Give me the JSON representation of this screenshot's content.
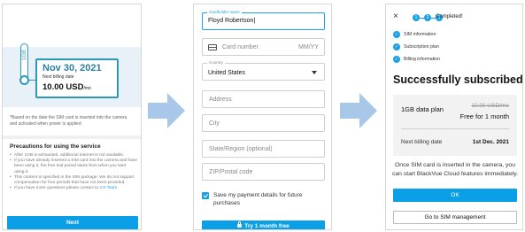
{
  "colors": {
    "accent": "#0a9fe6",
    "arrow": "#a9c7e8",
    "timeline": "#2c9ab7"
  },
  "panel1": {
    "timeline_label": "1GB",
    "billing_date": "Nov 30, 2021",
    "billing_caption": "Next billing date",
    "price": "10.00 USD",
    "price_unit": "/mo",
    "note": "*Based on the date the SIM card is inserted into the camera and activated when power is applied",
    "precautions_title": "Precautions for using the service",
    "precautions": [
      "After 1GB is exhausted, additional internet is not available.",
      "If you have already inserted a SIM card into the camera and have been using it, the free trial period starts from when you start using it.",
      "This content is specified in the SIM package. We do not support compensation for free periods that have not been provided.",
      "If you have more questions please contact to"
    ],
    "cs_link": "CS Team",
    "next_button": "Next"
  },
  "panel2": {
    "name_label": "Cardholder name",
    "name_value": "Floyd Robertson|",
    "card_placeholder": "Card number",
    "expiry_placeholder": "MM/YY",
    "country_label": "Country",
    "country_value": "United States",
    "address_placeholder": "Address",
    "city_placeholder": "City",
    "state_placeholder": "State/Region (optional)",
    "zip_placeholder": "ZIP/Postal code",
    "save_label": "Save my payment details for future purchases",
    "try_button": "Try 1 month free"
  },
  "panel3": {
    "close_icon": "×",
    "steps": [
      "1",
      "2",
      "3"
    ],
    "status": "Completed!",
    "checklist": [
      "SIM information",
      "Subscription plan",
      "Billing information"
    ],
    "title": "Successfully subscribed!",
    "plan_name": "1GB data plan",
    "plan_old_price": "10.00 USD/mo",
    "plan_offer": "Free for 1 month",
    "billing_label": "Next billing date",
    "billing_date": "1st Dec. 2021",
    "message": "Once SIM card is inserted in the camera, you can start BlackVue Cloud features immediately.",
    "ok_button": "OK",
    "sim_button": "Go to SIM management"
  }
}
